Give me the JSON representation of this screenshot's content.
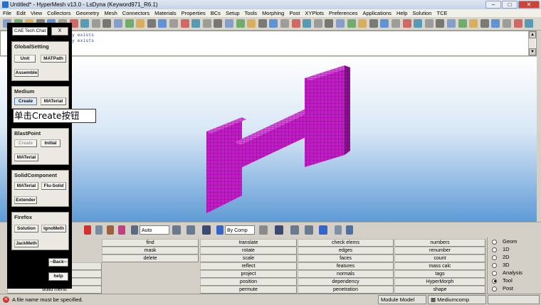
{
  "window": {
    "title": "Untitled* - HyperMesh v13.0 - LsDyna (Keyword971_R6.1)",
    "controls": [
      "–",
      "□",
      "✕"
    ]
  },
  "menubar": [
    "File",
    "Edit",
    "View",
    "Collectors",
    "Geometry",
    "Mesh",
    "Connectors",
    "Materials",
    "Properties",
    "BCs",
    "Setup",
    "Tools",
    "Morphing",
    "Post",
    "XYPlots",
    "Preferences",
    "Applications",
    "Help",
    "Solution",
    "TCE"
  ],
  "command_window": {
    "lines": [
      "ady exists",
      "ady exists"
    ]
  },
  "view_toolbar": {
    "auto_label": "Auto",
    "by_comp_label": "By Comp"
  },
  "overlay": {
    "title": "CAE Tech Chat",
    "close_label": "X",
    "annotation": "单击Create按钮",
    "groups": {
      "global": {
        "label": "GlobalSetting",
        "unit": "Unit",
        "matpath": "MATPath",
        "assemble": "Assemble"
      },
      "medium": {
        "label": "Medium",
        "create": "Create",
        "material": "MATerial"
      },
      "blast": {
        "label": "BlastPoint",
        "create": "Create",
        "initial": "Initial",
        "material": "MATerial"
      },
      "solid": {
        "label": "SolidComponent",
        "material": "MATerial",
        "flu_solid": "Flu-Solid",
        "extender": "Extender"
      },
      "firefox": {
        "label": "Firefox",
        "solution": "Solution",
        "ignometh": "IgnoMeth",
        "jackmeth": "JackMeth"
      }
    },
    "back_label": "--Back--",
    "help_label": "help"
  },
  "panel": {
    "col1": [
      "find",
      "mask",
      "delete"
    ],
    "col1_bottom": "build menu",
    "col2": [
      "translate",
      "rotate",
      "scale",
      "reflect",
      "project",
      "position",
      "permute"
    ],
    "col3": [
      "check elems",
      "edges",
      "faces",
      "features",
      "normals",
      "dependency",
      "penetration"
    ],
    "col4": [
      "numbers",
      "renumber",
      "count",
      "mass calc",
      "tags",
      "HyperMorph",
      "shape"
    ]
  },
  "radio_panel": {
    "options": [
      "Geom",
      "1D",
      "2D",
      "3D",
      "Analysis",
      "Tool",
      "Post"
    ],
    "selected": "Tool"
  },
  "statusbar": {
    "message": "A file name must be specified.",
    "model": "Module Model",
    "component": "Mediumcomp"
  },
  "colors": {
    "mesh_fill": "#c11cc6",
    "mesh_side": "#8e0f94",
    "mesh_top": "#d94ddc",
    "viewport_top": "#ffffff",
    "viewport_bottom": "#5f9bd6"
  }
}
